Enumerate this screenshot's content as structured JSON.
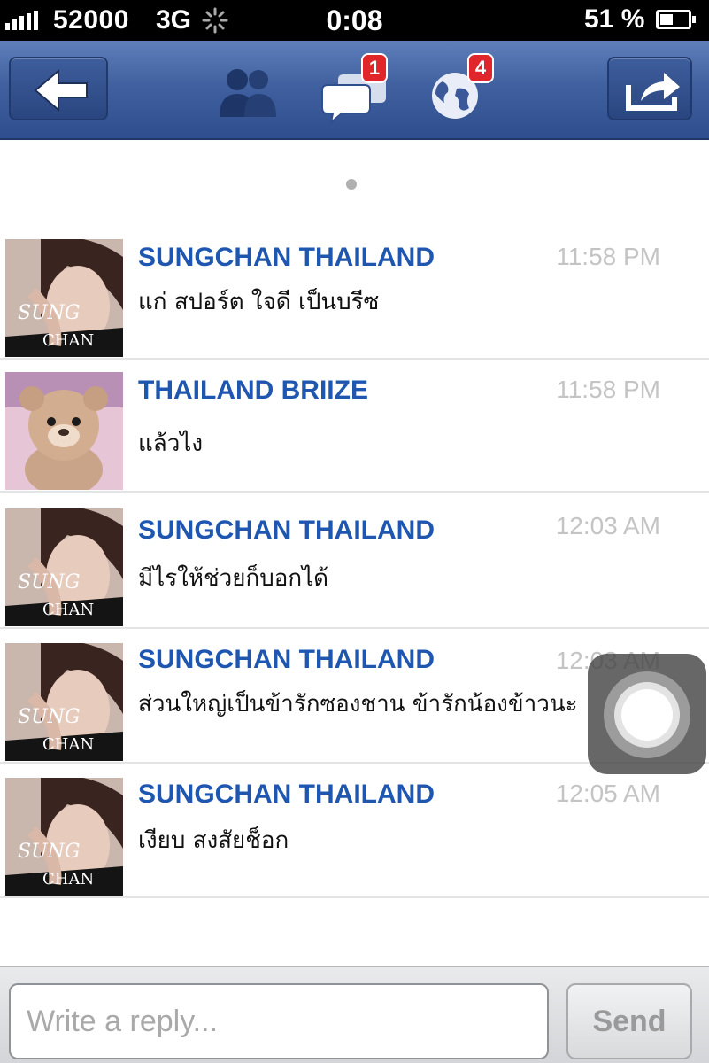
{
  "status_bar": {
    "carrier": "52000",
    "network": "3G",
    "time": "0:08",
    "battery": "51 %"
  },
  "nav": {
    "messages_badge": "1",
    "notifications_badge": "4"
  },
  "messages": [
    {
      "sender": "SUNGCHAN THAILAND",
      "time": "11:58 PM",
      "text": "แก่ สปอร์ต ใจดี เป็นบรีซ",
      "avatar": "sungchan"
    },
    {
      "sender": "THAILAND BRIIZE",
      "time": "11:58 PM",
      "text": "แล้วไง",
      "avatar": "bear"
    },
    {
      "sender": "SUNGCHAN THAILAND",
      "time": "12:03 AM",
      "text": "มีไรให้ช่วยก็บอกได้",
      "avatar": "sungchan"
    },
    {
      "sender": "SUNGCHAN THAILAND",
      "time": "12:03 AM",
      "text": "ส่วนใหญ่เป็นข้ารักซองชาน ข้ารักน้องข้าวนะ",
      "avatar": "sungchan"
    },
    {
      "sender": "SUNGCHAN THAILAND",
      "time": "12:05 AM",
      "text": "เงียบ สงสัยช็อก",
      "avatar": "sungchan"
    }
  ],
  "reply": {
    "placeholder": "Write a reply...",
    "send_label": "Send"
  },
  "colors": {
    "nav_blue": "#3b5998",
    "sender_blue": "#1f57b0",
    "badge_red": "#e0262b"
  }
}
